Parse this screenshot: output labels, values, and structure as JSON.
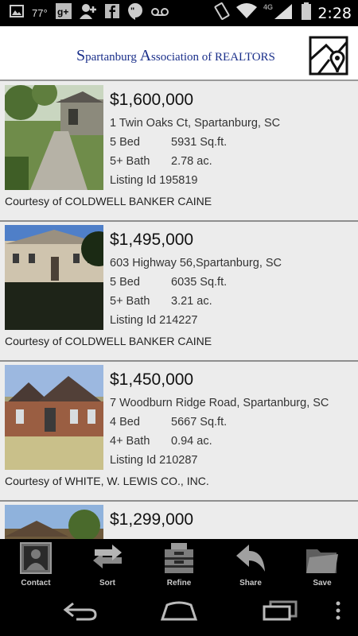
{
  "status_bar": {
    "temperature": "77°",
    "time": "2:28",
    "network": "4G"
  },
  "header": {
    "org_name_parts": [
      "S",
      "partanburg ",
      "A",
      "ssociation of ",
      "REALTORS"
    ],
    "logo_icon": "map-pin-logo-icon"
  },
  "listings": [
    {
      "price": "$1,600,000",
      "address": "1 Twin Oaks Ct, Spartanburg, SC",
      "beds": "5 Bed",
      "sqft": "5931 Sq.ft.",
      "baths": "5+ Bath",
      "acres": "2.78 ac.",
      "listing_id": "Listing Id 195819",
      "courtesy": "Courtesy of COLDWELL BANKER CAINE"
    },
    {
      "price": "$1,495,000",
      "address": "603 Highway 56,Spartanburg, SC",
      "beds": "5 Bed",
      "sqft": "6035 Sq.ft.",
      "baths": "5+ Bath",
      "acres": "3.21 ac.",
      "listing_id": "Listing Id 214227",
      "courtesy": "Courtesy of COLDWELL BANKER CAINE"
    },
    {
      "price": "$1,450,000",
      "address": "7 Woodburn Ridge Road, Spartanburg, SC",
      "beds": "4 Bed",
      "sqft": "5667 Sq.ft.",
      "baths": "4+ Bath",
      "acres": "0.94 ac.",
      "listing_id": "Listing Id 210287",
      "courtesy": "Courtesy of WHITE, W. LEWIS CO., INC."
    },
    {
      "price": "$1,299,000",
      "address": "",
      "beds": "",
      "sqft": "",
      "baths": "",
      "acres": "",
      "listing_id": "",
      "courtesy": ""
    }
  ],
  "action_bar": [
    {
      "label": "Contact",
      "icon": "contact-icon"
    },
    {
      "label": "Sort",
      "icon": "sort-arrows-icon"
    },
    {
      "label": "Refine",
      "icon": "refine-drawer-icon"
    },
    {
      "label": "Share",
      "icon": "share-arrow-icon"
    },
    {
      "label": "Save",
      "icon": "folder-icon"
    }
  ],
  "colors": {
    "brand_blue": "#1a2f8a",
    "background": "#ececec",
    "bar_black": "#000000"
  }
}
